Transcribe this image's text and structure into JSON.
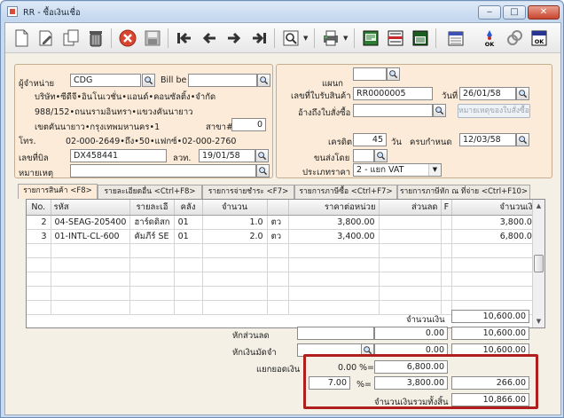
{
  "window": {
    "title": "RR - ซื้อเงินเชื่อ",
    "minimize": "‒",
    "maximize": "□",
    "close": "✕"
  },
  "toolbar": {
    "items": [
      "new-document-icon",
      "edit-icon",
      "trash-icon",
      "cancel-icon",
      "save-icon",
      "first-record-icon",
      "previous-record-icon",
      "next-record-icon",
      "last-record-icon",
      "search-icon",
      "print-icon",
      "preview-icon",
      "report-icon",
      "export-icon",
      "approve-icon",
      "unapprove-icon",
      "ok-exit-icon"
    ]
  },
  "supplier": {
    "code_label": "ผู้จำหน่าย",
    "code_value": "CDG",
    "billbe_label": "Bill be",
    "billbe_value": "",
    "name": "บริษัท•ซีดีจี•อินโนเวชั่น•แอนด์•คอนซัลติ้ง•จำกัด",
    "addr1": "988/152•ถนนรามอินทรา•แขวงคันนายาว",
    "addr2": "เขตคันนายาว•กรุงเทพมหานคร•1",
    "branch_label": "สาขา#",
    "branch_value": "0",
    "tel_label": "โทร.",
    "tel_value": "02-000-2649•ถึง•50•แฟกซ์•02-000-2760",
    "bill_label": "เลขที่บิล",
    "bill_value": "DX458441",
    "bill_date_label": "ลวท.",
    "bill_date_value": "19/01/58",
    "note_label": "หมายเหตุ",
    "note_value": ""
  },
  "doc": {
    "dept_label": "แผนก",
    "dept_value": "",
    "receipt_label": "เลขที่ใบรับสินค้า",
    "receipt_value": "RR0000005",
    "date_label": "วันที่",
    "date_value": "26/01/58",
    "po_label": "อ้างถึงใบสั่งซื้อ",
    "po_value": "",
    "po_note_button": "หมายเหตุของใบสั่งซื้อ",
    "credit_label": "เครดิต",
    "credit_value": "45",
    "credit_unit": "วัน",
    "due_label": "ครบกำหนด",
    "due_value": "12/03/58",
    "ship_label": "ขนส่งโดย",
    "ship_value": "",
    "price_type_label": "ประเภทราคา",
    "price_type_value": "2 - แยก VAT"
  },
  "tabs": [
    "รายการสินค้า <F8>",
    "รายละเอียดอื่น <Ctrl+F8>",
    "รายการจ่ายชำระ <F7>",
    "รายการภาษีซื้อ <Ctrl+F7>",
    "รายการภาษีหัก ณ ที่จ่าย <Ctrl+F10>"
  ],
  "table": {
    "headers": [
      "No.",
      "รหัส",
      "รายละเอี",
      "คลัง",
      "จำนวน",
      "",
      "ราคาต่อหน่วย",
      "ส่วนลด",
      "F",
      "จำนวนเงิน"
    ],
    "rows": [
      [
        "2",
        "04-SEAG-205400",
        "ฮาร์ดดิสก",
        "01",
        "1.0",
        "ตว",
        "3,800.00",
        "",
        "",
        "3,800.00"
      ],
      [
        "3",
        "01-INTL-CL-600",
        "คัมภีร์ SE",
        "01",
        "2.0",
        "ตว",
        "3,400.00",
        "",
        "",
        "6,800.00"
      ]
    ]
  },
  "totals": {
    "amount_label": "จำนวนเงิน",
    "amount_value": "10,600.00",
    "discount_label": "หักส่วนลด",
    "discount_input": "",
    "discount_value": "0.00",
    "after_discount": "10,600.00",
    "deposit_label": "หักเงินมัดจำ",
    "deposit_input": "",
    "deposit_value": "0.00",
    "after_deposit": "10,600.00",
    "split_label": "แยกยอดเงิน",
    "vat0_rate": "0.00",
    "vat0_pct_label": "%=",
    "vat0_base": "6,800.00",
    "vat7_rate": "7.00",
    "vat7_pct_label": "%=",
    "vat7_base": "3,800.00",
    "vat7_amount": "266.00",
    "grand_label": "จำนวนเงินรวมทั้งสิ้น",
    "grand_value": "10,866.00"
  }
}
